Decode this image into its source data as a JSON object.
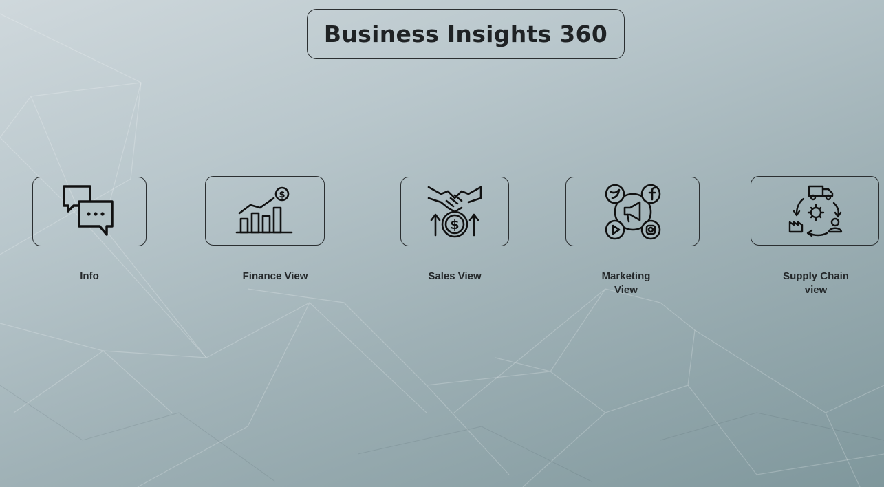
{
  "header": {
    "title": "Business Insights 360"
  },
  "nav": {
    "info": {
      "label": "Info",
      "icon": "chat-bubbles-icon"
    },
    "finance": {
      "label": "Finance View",
      "icon": "growth-chart-dollar-icon"
    },
    "sales": {
      "label": "Sales View",
      "icon": "handshake-coin-icon"
    },
    "marketing": {
      "label": "Marketing\nView",
      "icon": "social-media-megaphone-icon"
    },
    "supply_chain": {
      "label": "Supply Chain\nview",
      "icon": "supply-cycle-icon"
    }
  },
  "colors": {
    "stroke": "#111111",
    "border": "#2b2f31",
    "text": "#24282a"
  }
}
